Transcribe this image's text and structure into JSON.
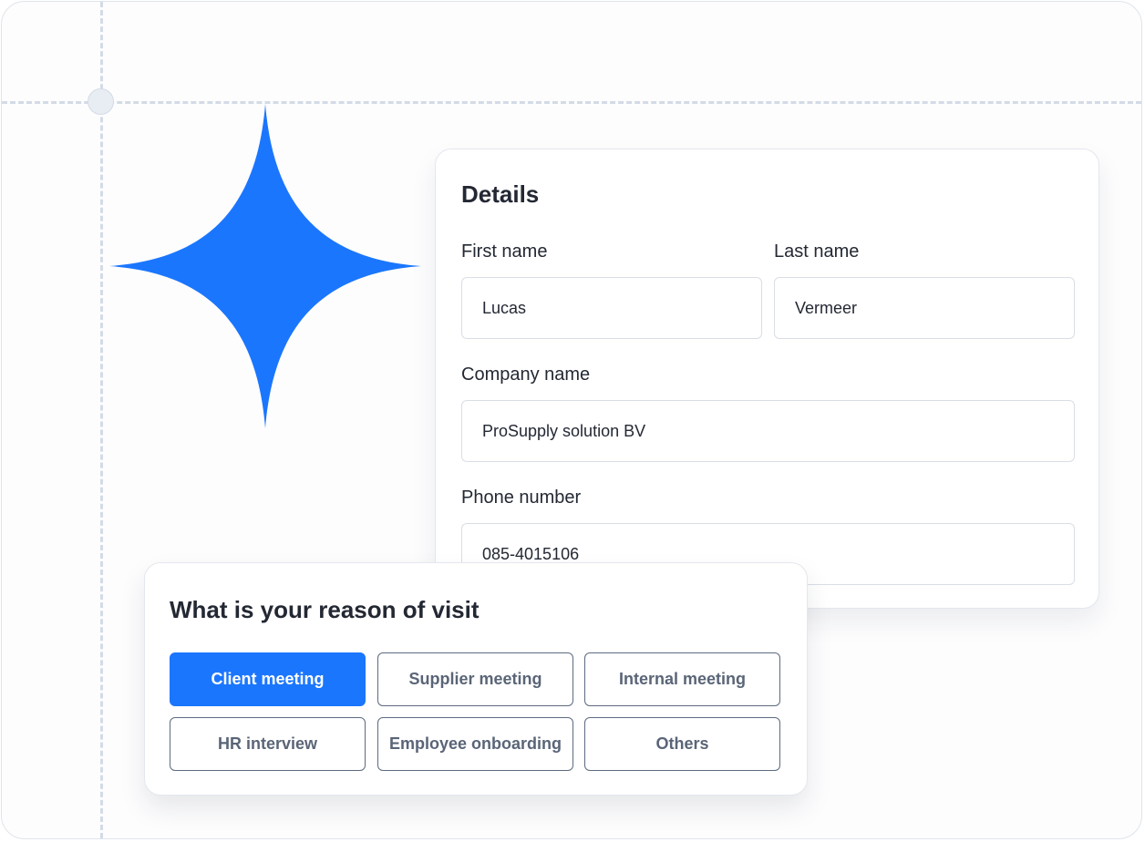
{
  "details": {
    "title": "Details",
    "first_name": {
      "label": "First name",
      "value": "Lucas"
    },
    "last_name": {
      "label": "Last name",
      "value": "Vermeer"
    },
    "company_name": {
      "label": "Company name",
      "value": "ProSupply solution BV"
    },
    "phone_number": {
      "label": "Phone number",
      "value": "085-4015106"
    }
  },
  "reason": {
    "title": "What is your reason of visit",
    "selected": "Client meeting",
    "options": [
      "Client meeting",
      "Supplier meeting",
      "Internal meeting",
      "HR interview",
      "Employee onboarding",
      "Others"
    ]
  },
  "colors": {
    "accent": "#1b76fe",
    "sparkle": "#1b76fe",
    "guide": "#d3dbe6",
    "border": "#d9dee6"
  },
  "icons": {
    "decoration": "sparkle-icon"
  }
}
